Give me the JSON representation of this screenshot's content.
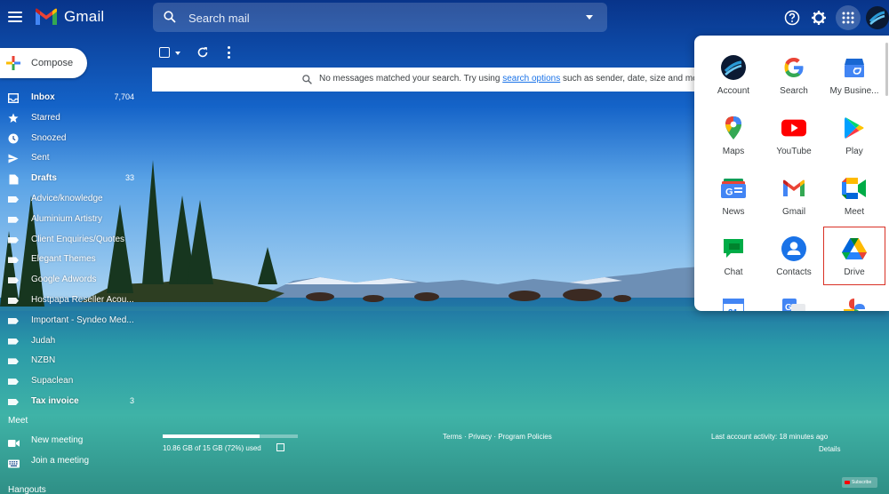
{
  "header": {
    "app_name": "Gmail",
    "search_placeholder": "Search mail",
    "icons": [
      "menu-icon",
      "search-icon",
      "search-options-icon",
      "help-icon",
      "settings-icon",
      "apps-icon",
      "avatar"
    ]
  },
  "sidebar": {
    "compose_label": "Compose",
    "items": [
      {
        "label": "Inbox",
        "count": "7,704",
        "icon": "inbox-icon"
      },
      {
        "label": "Starred",
        "count": "",
        "icon": "star-icon"
      },
      {
        "label": "Snoozed",
        "count": "",
        "icon": "clock-icon"
      },
      {
        "label": "Sent",
        "count": "",
        "icon": "send-icon"
      },
      {
        "label": "Drafts",
        "count": "33",
        "icon": "draft-icon"
      },
      {
        "label": "Advice/knowledge",
        "count": "",
        "icon": "label-icon"
      },
      {
        "label": "Aluminium Artistry",
        "count": "",
        "icon": "label-icon"
      },
      {
        "label": "Client Enquiries/Quotes",
        "count": "",
        "icon": "label-icon"
      },
      {
        "label": "Elegant Themes",
        "count": "",
        "icon": "label-icon"
      },
      {
        "label": "Google Adwords",
        "count": "",
        "icon": "label-icon"
      },
      {
        "label": "Hostpapa Reseller Acou...",
        "count": "",
        "icon": "label-icon"
      },
      {
        "label": "Important - Syndeo Med...",
        "count": "",
        "icon": "label-icon"
      },
      {
        "label": "Judah",
        "count": "",
        "icon": "label-icon"
      },
      {
        "label": "NZBN",
        "count": "",
        "icon": "label-icon"
      },
      {
        "label": "Supaclean",
        "count": "",
        "icon": "label-icon"
      },
      {
        "label": "Tax invoice",
        "count": "3",
        "icon": "label-icon"
      }
    ],
    "meet_heading": "Meet",
    "meet_items": [
      {
        "label": "New meeting",
        "icon": "video-icon"
      },
      {
        "label": "Join a meeting",
        "icon": "keyboard-icon"
      }
    ],
    "hangouts_heading": "Hangouts"
  },
  "message": {
    "text_before": "No messages matched your search. Try using ",
    "link_text": "search options",
    "text_after": " such as sender, date, size and mo"
  },
  "footer": {
    "storage_text": "10.86 GB of 15 GB (72%) used",
    "storage_percent": 72,
    "links": {
      "terms": "Terms",
      "privacy": "Privacy",
      "policies": "Program Policies",
      "separator": " · "
    },
    "activity": "Last account activity: 18 minutes ago",
    "details": "Details",
    "subscribe": "Subscribe"
  },
  "apps": [
    {
      "label": "Account",
      "icon": "account-icon"
    },
    {
      "label": "Search",
      "icon": "google-search-icon"
    },
    {
      "label": "My Busine...",
      "icon": "business-icon"
    },
    {
      "label": "Maps",
      "icon": "maps-icon"
    },
    {
      "label": "YouTube",
      "icon": "youtube-icon"
    },
    {
      "label": "Play",
      "icon": "play-icon"
    },
    {
      "label": "News",
      "icon": "news-icon"
    },
    {
      "label": "Gmail",
      "icon": "gmail-icon"
    },
    {
      "label": "Meet",
      "icon": "meet-icon"
    },
    {
      "label": "Chat",
      "icon": "chat-icon"
    },
    {
      "label": "Contacts",
      "icon": "contacts-icon"
    },
    {
      "label": "Drive",
      "icon": "drive-icon",
      "selected": true
    },
    {
      "label": "",
      "icon": "calendar-icon"
    },
    {
      "label": "",
      "icon": "translate-icon"
    },
    {
      "label": "",
      "icon": "photos-icon"
    }
  ],
  "colors": {
    "selection_outline": "#d93025",
    "link": "#1a73e8",
    "panel_text": "#3c4043"
  }
}
